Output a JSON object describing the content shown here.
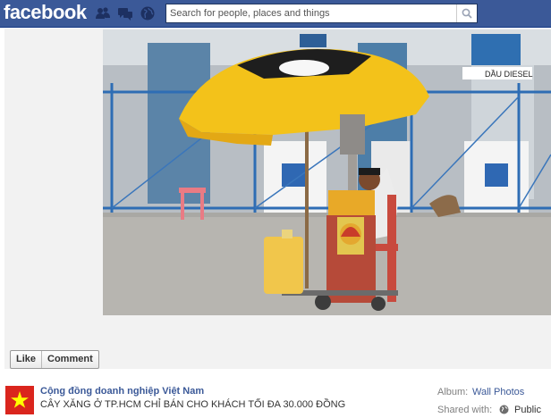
{
  "header": {
    "logo": "facebook",
    "search_placeholder": "Search for people, places and things",
    "icons": [
      "friend-requests-icon",
      "messages-icon",
      "notifications-icon",
      "search-icon"
    ]
  },
  "photo": {
    "description_icon": "photo-image"
  },
  "actions": {
    "like_label": "Like",
    "comment_label": "Comment"
  },
  "post": {
    "page_name": "Cộng đồng doanh nghiệp Việt Nam",
    "caption": "CÂY XĂNG Ở TP.HCM CHỈ BÁN CHO KHÁCH TỐI ĐA 30.000 ĐỒNG",
    "album_label": "Album:",
    "album_value": "Wall Photos",
    "shared_label": "Shared with:",
    "shared_value": "Public",
    "shared_icon": "globe-icon"
  },
  "colors": {
    "brand": "#3b5998",
    "flag_red": "#da251d",
    "flag_star": "#ffff00"
  }
}
